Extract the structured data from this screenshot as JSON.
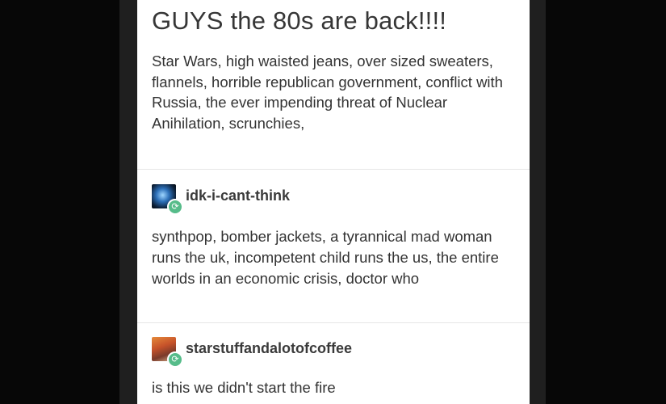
{
  "post": {
    "title": "GUYS the 80s are back!!!!",
    "body": "Star Wars, high waisted jeans, over sized sweaters, flannels, horrible republican government, conflict with Russia, the ever impending threat of Nuclear Anihilation, scrunchies,"
  },
  "reblogs": [
    {
      "username": "idk-i-cant-think",
      "text": "synthpop, bomber jackets, a tyrannical mad woman runs the uk, incompetent child runs the us, the entire worlds in an economic crisis, doctor who",
      "badge_glyph": "⟳"
    },
    {
      "username": "starstuffandalotofcoffee",
      "text": "is this we didn't start the fire",
      "badge_glyph": "⟳"
    }
  ],
  "colors": {
    "background": "#000000",
    "card": "#ffffff",
    "text": "#333333",
    "reblog_badge": "#56bc8a"
  }
}
